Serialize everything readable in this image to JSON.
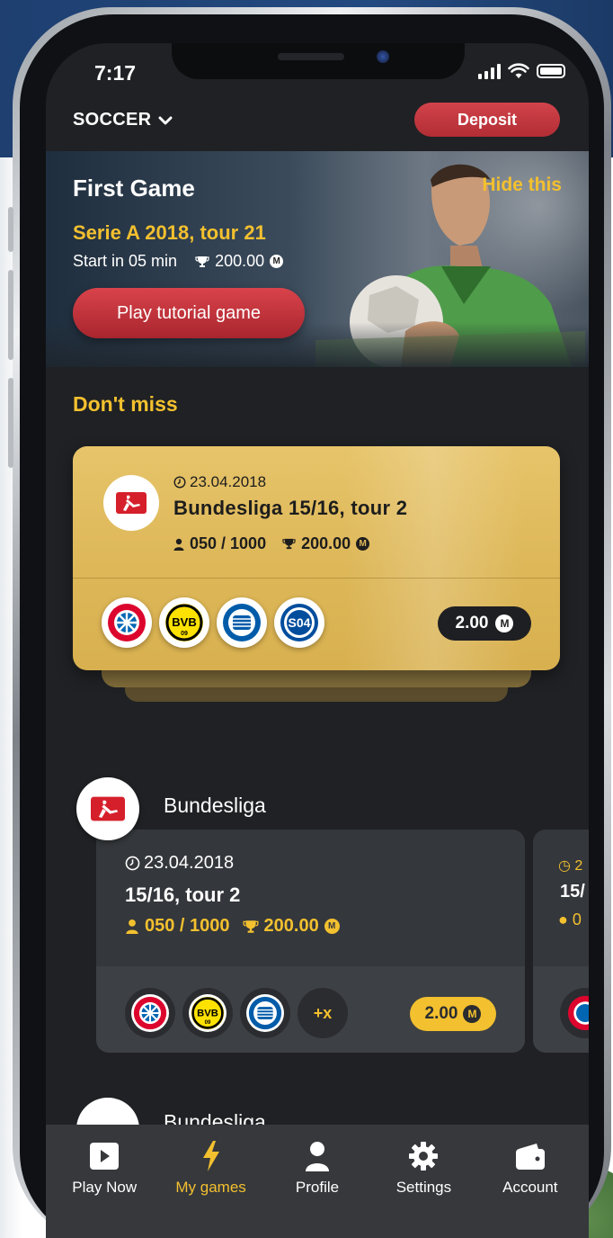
{
  "status_bar": {
    "time": "7:17"
  },
  "header": {
    "sport": "SOCCER",
    "deposit_label": "Deposit"
  },
  "banner": {
    "title": "First Game",
    "hide_label": "Hide this",
    "subtitle": "Serie A 2018, tour 21",
    "start_text": "Start in 05 min",
    "prize": "200.00",
    "coin_symbol": "M",
    "cta_label": "Play tutorial game"
  },
  "dont_miss": {
    "title": "Don't miss",
    "card": {
      "date": "23.04.2018",
      "title": "Bundesliga 15/16, tour 2",
      "players": "050 / 1000",
      "prize": "200.00",
      "price": "2.00",
      "teams": [
        "bayern-logo",
        "bvb-logo",
        "hertha-logo",
        "schalke-logo"
      ]
    }
  },
  "leagues": [
    {
      "name": "Bundesliga",
      "card": {
        "date": "23.04.2018",
        "title": "15/16, tour 2",
        "players": "050 / 1000",
        "prize": "200.00",
        "more_label": "+x",
        "price": "2.00"
      },
      "peek": {
        "date": "2",
        "title": "15/",
        "stats": "0"
      }
    },
    {
      "name": "Bundesliga"
    }
  ],
  "tabs": [
    {
      "label": "Play Now",
      "icon": "play-icon"
    },
    {
      "label": "My games",
      "icon": "lightning-icon",
      "active": true
    },
    {
      "label": "Profile",
      "icon": "person-icon"
    },
    {
      "label": "Settings",
      "icon": "gear-icon"
    },
    {
      "label": "Account",
      "icon": "wallet-icon"
    }
  ],
  "colors": {
    "accent": "#f3c02f",
    "danger": "#c2373f",
    "background": "#1f2124",
    "gold_card": "#ddb758"
  }
}
